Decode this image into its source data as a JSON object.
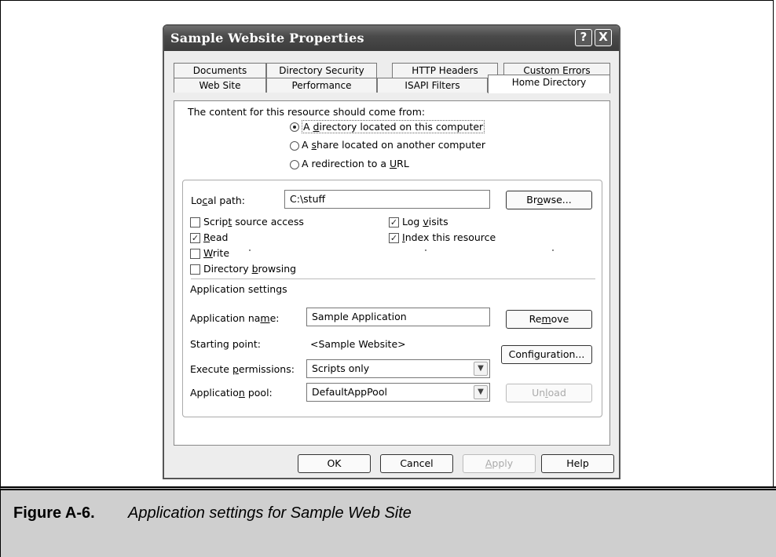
{
  "window": {
    "title": "Sample Website Properties",
    "help_glyph": "?",
    "close_glyph": "X"
  },
  "tabs": {
    "row1": [
      "Documents",
      "Directory Security",
      "HTTP Headers",
      "Custom Errors"
    ],
    "row2": [
      "Web Site",
      "Performance",
      "ISAPI Filters",
      "Home Directory"
    ],
    "active": "Home Directory"
  },
  "content_source": {
    "label": "The content for this resource should come from:",
    "options": [
      {
        "pre": "A ",
        "key": "d",
        "post": "irectory located on this computer",
        "selected": true
      },
      {
        "pre": "A ",
        "key": "s",
        "post": "hare located on another computer",
        "selected": false
      },
      {
        "pre": "A redirection to a ",
        "key": "U",
        "post": "RL",
        "selected": false
      }
    ]
  },
  "local_path": {
    "label_pre": "Lo",
    "label_key": "c",
    "label_post": "al path:",
    "value": "C:\\stuff",
    "browse_pre": "Br",
    "browse_key": "o",
    "browse_post": "wse..."
  },
  "checkboxes": {
    "script_source": {
      "pre": "Scrip",
      "key": "t",
      "post": " source access",
      "checked": false
    },
    "read": {
      "pre": "",
      "key": "R",
      "post": "ead",
      "checked": true
    },
    "write": {
      "pre": "",
      "key": "W",
      "post": "rite",
      "checked": false
    },
    "dir_browsing": {
      "pre": "Directory ",
      "key": "b",
      "post": "rowsing",
      "checked": false
    },
    "log_visits": {
      "pre": "Log ",
      "key": "v",
      "post": "isits",
      "checked": true
    },
    "index": {
      "pre": "",
      "key": "I",
      "post": "ndex this resource",
      "checked": true
    }
  },
  "app_settings": {
    "heading": "Application settings",
    "name_label_pre": "Application na",
    "name_label_key": "m",
    "name_label_post": "e:",
    "name_value": "Sample Application",
    "remove_pre": "Re",
    "remove_key": "m",
    "remove_post": "ove",
    "starting_point_label": "Starting point:",
    "starting_point_value": "<Sample Website>",
    "config_pre": "Confi",
    "config_key": "g",
    "config_post": "uration...",
    "exec_label_pre": "Execute ",
    "exec_label_key": "p",
    "exec_label_post": "ermissions:",
    "exec_value": "Scripts only",
    "pool_label_pre": "Applicatio",
    "pool_label_key": "n",
    "pool_label_post": " pool:",
    "pool_value": "DefaultAppPool",
    "unload_pre": "Un",
    "unload_key": "l",
    "unload_post": "oad"
  },
  "footer": {
    "ok": "OK",
    "cancel": "Cancel",
    "apply_pre": "",
    "apply_key": "A",
    "apply_post": "pply",
    "help": "Help"
  },
  "caption": {
    "label": "Figure A-6.",
    "text": "Application settings for Sample Web Site"
  },
  "dropdown_glyph": "▼",
  "check_glyph": "✓"
}
